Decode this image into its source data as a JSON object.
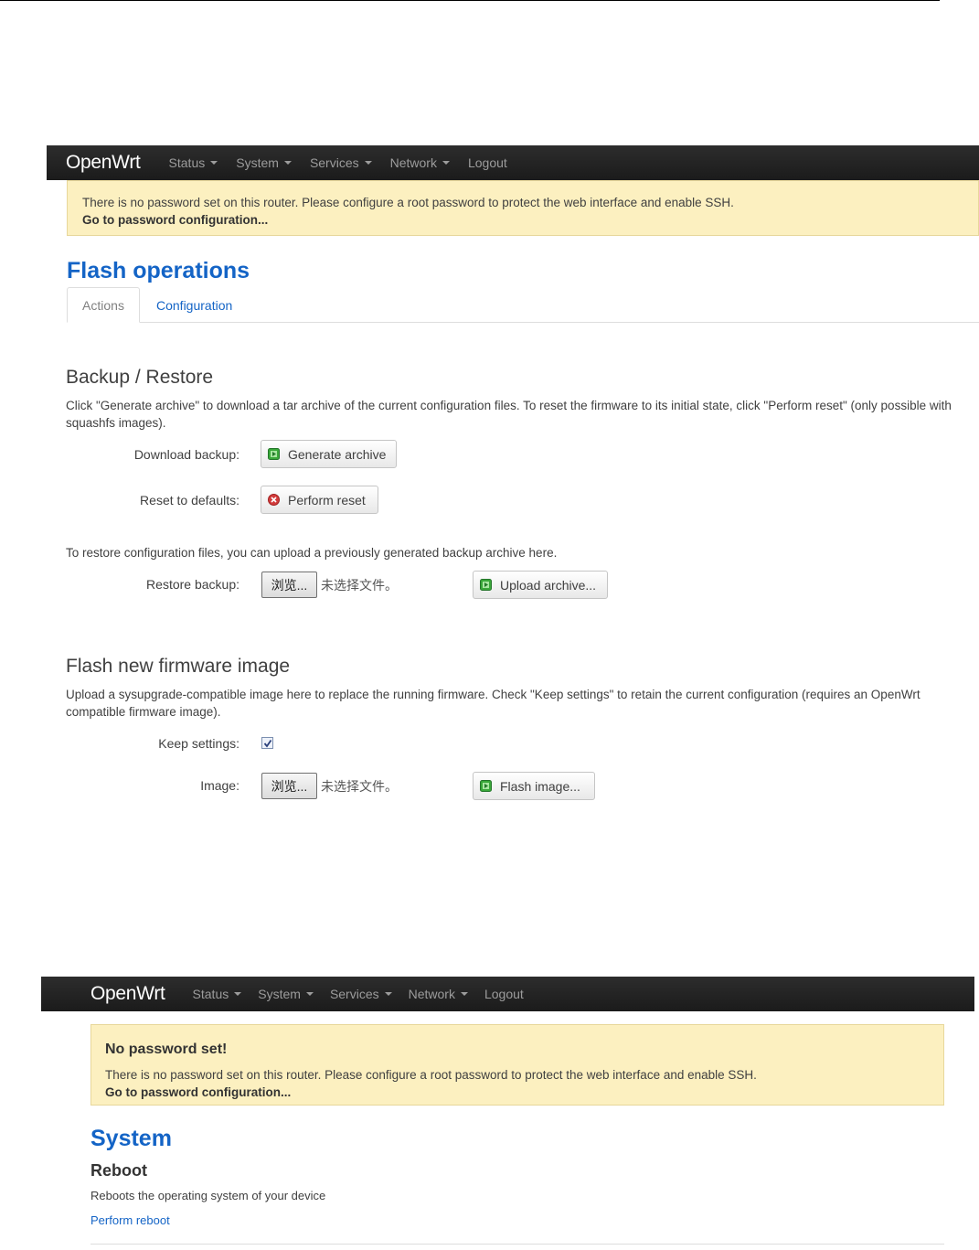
{
  "nav": {
    "brand": "OpenWrt",
    "menu": [
      {
        "label": "Status",
        "has_caret": true
      },
      {
        "label": "System",
        "has_caret": true
      },
      {
        "label": "Services",
        "has_caret": true
      },
      {
        "label": "Network",
        "has_caret": true
      },
      {
        "label": "Logout",
        "has_caret": false
      }
    ]
  },
  "screen1": {
    "alert": {
      "text": "There is no password set on this router. Please configure a root password to protect the web interface and enable SSH.",
      "link": "Go to password configuration..."
    },
    "page_title": "Flash operations",
    "tabs": [
      {
        "label": "Actions",
        "active": true
      },
      {
        "label": "Configuration",
        "active": false
      }
    ],
    "backup": {
      "title": "Backup / Restore",
      "description": "Click \"Generate archive\" to download a tar archive of the current configuration files. To reset the firmware to its initial state, click \"Perform reset\" (only possible with squashfs images).",
      "download_label": "Download backup:",
      "generate_button": "Generate archive",
      "reset_label": "Reset to defaults:",
      "reset_button": "Perform reset",
      "restore_description": "To restore configuration files, you can upload a previously generated backup archive here.",
      "restore_label": "Restore backup:",
      "browse_button": "浏览...",
      "no_file": "未选择文件。",
      "upload_button": "Upload archive..."
    },
    "flash": {
      "title": "Flash new firmware image",
      "description": "Upload a sysupgrade-compatible image here to replace the running firmware. Check \"Keep settings\" to retain the current configuration (requires an OpenWrt compatible firmware image).",
      "keep_label": "Keep settings:",
      "keep_checked": true,
      "image_label": "Image:",
      "browse_button": "浏览...",
      "no_file": "未选择文件。",
      "flash_button": "Flash image..."
    }
  },
  "screen2": {
    "alert": {
      "title": "No password set!",
      "text": "There is no password set on this router. Please configure a root password to protect the web interface and enable SSH.",
      "link": "Go to password configuration..."
    },
    "page_title": "System",
    "section_title": "Reboot",
    "description": "Reboots the operating system of your device",
    "reboot_link": "Perform reboot"
  },
  "colors": {
    "navbar": "#1b1b1b",
    "link": "#1464c6",
    "alert_bg": "#fcf0c0",
    "apply_icon": "#3aa83a",
    "reset_icon": "#d23c3c"
  }
}
